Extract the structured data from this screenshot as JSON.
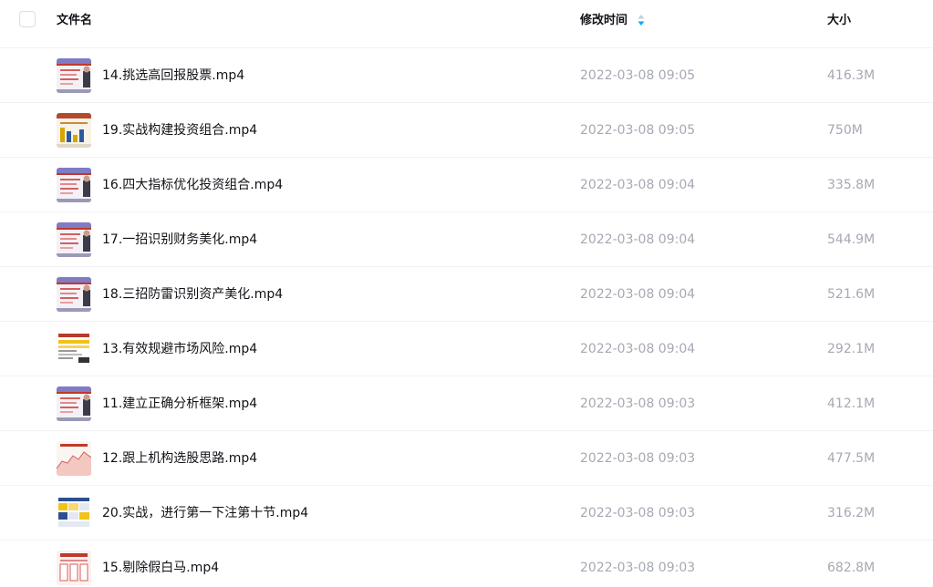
{
  "header": {
    "name_label": "文件名",
    "mtime_label": "修改时间",
    "size_label": "大小",
    "sort_icon": "sort-arrows-icon",
    "accent_color": "#06a7ff"
  },
  "files": [
    {
      "name": "14.挑选高回报股票.mp4",
      "modified": "2022-03-08 09:05",
      "size": "416.3M",
      "thumb": "video-thumbnail-lecture"
    },
    {
      "name": "19.实战构建投资组合.mp4",
      "modified": "2022-03-08 09:05",
      "size": "750M",
      "thumb": "video-thumbnail-bar-slide"
    },
    {
      "name": "16.四大指标优化投资组合.mp4",
      "modified": "2022-03-08 09:04",
      "size": "335.8M",
      "thumb": "video-thumbnail-lecture"
    },
    {
      "name": "17.一招识别财务美化.mp4",
      "modified": "2022-03-08 09:04",
      "size": "544.9M",
      "thumb": "video-thumbnail-lecture"
    },
    {
      "name": "18.三招防雷识别资产美化.mp4",
      "modified": "2022-03-08 09:04",
      "size": "521.6M",
      "thumb": "video-thumbnail-lecture"
    },
    {
      "name": "13.有效规避市场风险.mp4",
      "modified": "2022-03-08 09:04",
      "size": "292.1M",
      "thumb": "video-thumbnail-yellow-slide"
    },
    {
      "name": "11.建立正确分析框架.mp4",
      "modified": "2022-03-08 09:03",
      "size": "412.1M",
      "thumb": "video-thumbnail-lecture"
    },
    {
      "name": "12.跟上机构选股思路.mp4",
      "modified": "2022-03-08 09:03",
      "size": "477.5M",
      "thumb": "video-thumbnail-area-chart"
    },
    {
      "name": "20.实战，进行第一下注第十节.mp4",
      "modified": "2022-03-08 09:03",
      "size": "316.2M",
      "thumb": "video-thumbnail-table-slide"
    },
    {
      "name": "15.剔除假白马.mp4",
      "modified": "2022-03-08 09:03",
      "size": "682.8M",
      "thumb": "video-thumbnail-red-slide"
    }
  ]
}
